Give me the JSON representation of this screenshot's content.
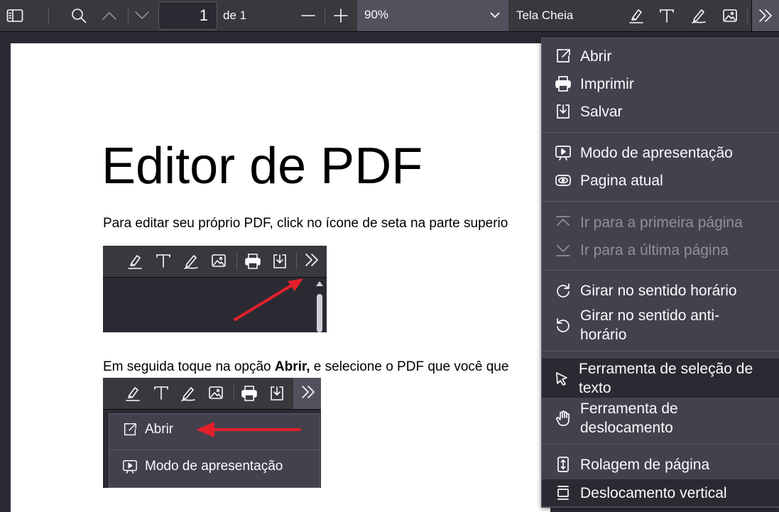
{
  "toolbar": {
    "page_number": "1",
    "page_of": "de 1",
    "zoom_value": "90%",
    "fullscreen_label": "Tela Cheia",
    "icons": [
      "sidebar-toggle-icon",
      "search-icon",
      "chevron-up-icon",
      "chevron-down-icon",
      "zoom-out-icon",
      "zoom-in-icon",
      "highlight-icon",
      "text-icon",
      "draw-icon",
      "image-icon",
      "double-chevron-right-icon"
    ]
  },
  "document": {
    "title": "Editor de PDF",
    "para1": "Para editar seu próprio PDF, click no ícone de seta na parte superio",
    "para2_before": "Em seguida toque na opção ",
    "para2_bold": "Abrir,",
    "para2_after": " e selecione o PDF que você que",
    "shot2_menu": {
      "open_label": "Abrir",
      "presentation_label": "Modo de apresentação"
    }
  },
  "menu": {
    "items": [
      {
        "label": "Abrir",
        "icon": "open-external-icon"
      },
      {
        "label": "Imprimir",
        "icon": "print-icon"
      },
      {
        "label": "Salvar",
        "icon": "save-download-icon"
      },
      {
        "label": "Modo de apresentação",
        "icon": "presentation-icon"
      },
      {
        "label": "Pagina atual",
        "icon": "eye-icon"
      },
      {
        "label": "Ir para a primeira página",
        "icon": "first-page-icon",
        "disabled": true
      },
      {
        "label": "Ir para a última página",
        "icon": "last-page-icon",
        "disabled": true
      },
      {
        "label": "Girar no sentido horário",
        "icon": "rotate-clockwise-icon"
      },
      {
        "label": "Girar no sentido anti-horário",
        "icon": "rotate-counterclockwise-icon"
      },
      {
        "label": "Ferramenta de seleção de texto",
        "icon": "cursor-icon",
        "active": true
      },
      {
        "label": "Ferramenta de deslocamento",
        "icon": "hand-icon"
      },
      {
        "label": "Rolagem de página",
        "icon": "page-scroll-icon"
      },
      {
        "label": "Deslocamento vertical",
        "icon": "vertical-scroll-icon",
        "active": true
      }
    ]
  },
  "colors": {
    "toolbar_bg": "#38383d",
    "menu_bg": "#42414d",
    "active_bg": "#2b2a33",
    "arrow_red": "#e3202a"
  }
}
